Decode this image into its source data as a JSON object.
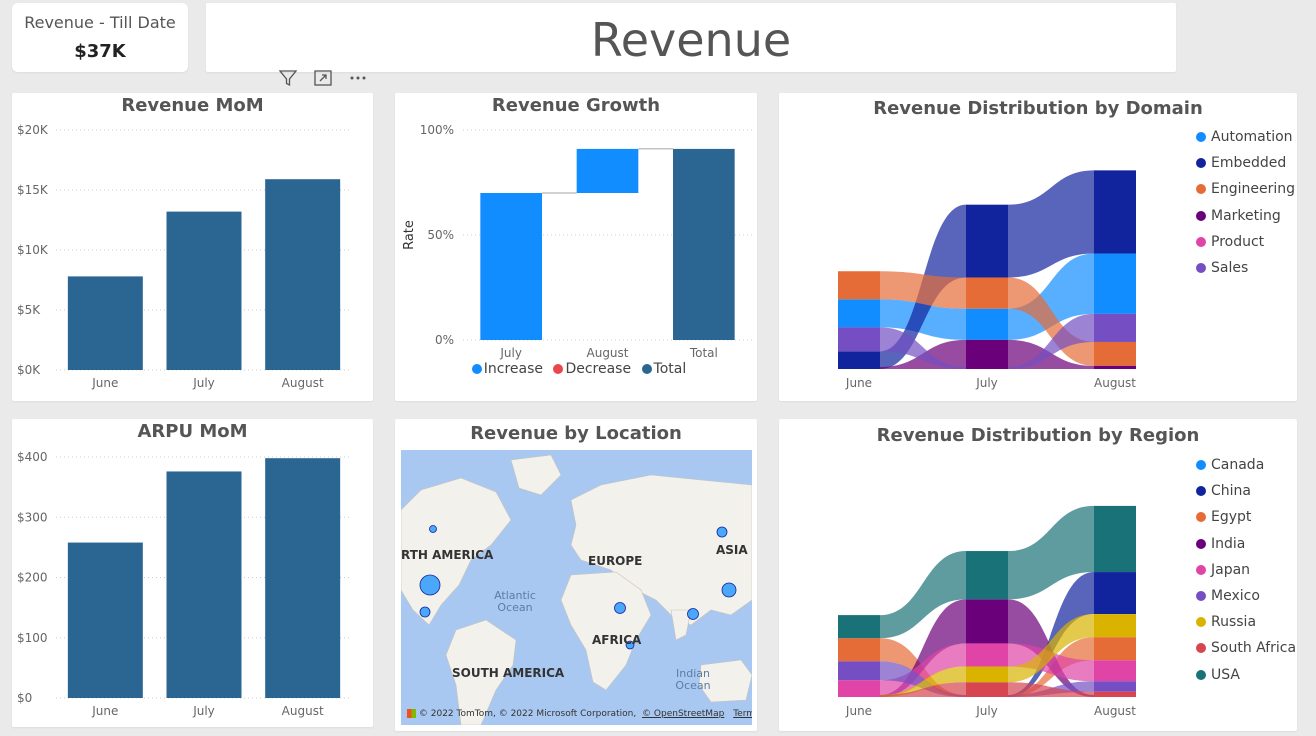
{
  "kpi": {
    "label": "Revenue - Till Date",
    "value": "$37K"
  },
  "header": {
    "title": "Revenue"
  },
  "chart_data": [
    {
      "id": "revenue_mom",
      "type": "bar",
      "title": "Revenue MoM",
      "categories": [
        "June",
        "July",
        "August"
      ],
      "values": [
        7800,
        13200,
        15900
      ],
      "ylim": [
        0,
        20000
      ],
      "yticks": [
        "$0K",
        "$5K",
        "$10K",
        "$15K",
        "$20K"
      ],
      "color": "#2b6591",
      "grid": true
    },
    {
      "id": "revenue_growth",
      "type": "bar",
      "subtype": "waterfall",
      "title": "Revenue Growth",
      "ylabel": "Rate",
      "categories": [
        "July",
        "August",
        "Total"
      ],
      "steps": [
        {
          "category": "July",
          "start": 0,
          "end": 70,
          "kind": "Increase"
        },
        {
          "category": "August",
          "start": 70,
          "end": 91,
          "kind": "Increase"
        },
        {
          "category": "Total",
          "start": 0,
          "end": 91,
          "kind": "Total"
        }
      ],
      "yticks": [
        "0%",
        "50%",
        "100%"
      ],
      "ylim": [
        0,
        100
      ],
      "legend": [
        {
          "label": "Increase",
          "color": "#118dff"
        },
        {
          "label": "Decrease",
          "color": "#e8484c"
        },
        {
          "label": "Total",
          "color": "#2b6591"
        }
      ]
    },
    {
      "id": "revenue_by_domain",
      "type": "area",
      "subtype": "ribbon",
      "title": "Revenue Distribution by Domain",
      "categories": [
        "June",
        "July",
        "August"
      ],
      "series": [
        {
          "name": "Automation",
          "color": "#118dff",
          "values": [
            2.7,
            3.0,
            5.8
          ]
        },
        {
          "name": "Embedded",
          "color": "#12239e",
          "values": [
            1.7,
            7.0,
            8.0
          ]
        },
        {
          "name": "Engineering",
          "color": "#e66c37",
          "values": [
            2.7,
            3.0,
            2.3
          ]
        },
        {
          "name": "Marketing",
          "color": "#6b007b",
          "values": [
            0,
            2.8,
            0.3
          ]
        },
        {
          "name": "Product",
          "color": "#e044a7",
          "values": [
            0,
            0,
            0
          ]
        },
        {
          "name": "Sales",
          "color": "#744ec2",
          "values": [
            2.3,
            0,
            2.7
          ]
        }
      ],
      "legend": [
        "Automation",
        "Embedded",
        "Engineering",
        "Marketing",
        "Product",
        "Sales"
      ]
    },
    {
      "id": "arpu_mom",
      "type": "bar",
      "title": "ARPU MoM",
      "categories": [
        "June",
        "July",
        "August"
      ],
      "values": [
        258,
        376,
        398
      ],
      "ylim": [
        0,
        400
      ],
      "yticks": [
        "$0",
        "$100",
        "$200",
        "$300",
        "$400"
      ],
      "color": "#2b6591",
      "grid": true
    },
    {
      "id": "revenue_by_region",
      "type": "area",
      "subtype": "ribbon",
      "title": "Revenue Distribution by Region",
      "categories": [
        "June",
        "July",
        "August"
      ],
      "series": [
        {
          "name": "Canada",
          "color": "#118dff",
          "values": [
            0,
            0,
            0
          ]
        },
        {
          "name": "China",
          "color": "#12239e",
          "values": [
            0,
            0,
            4.0
          ]
        },
        {
          "name": "Egypt",
          "color": "#e66c37",
          "values": [
            2.2,
            0,
            2.2
          ]
        },
        {
          "name": "India",
          "color": "#6b007b",
          "values": [
            0,
            4.2,
            0
          ]
        },
        {
          "name": "Japan",
          "color": "#e044a7",
          "values": [
            1.6,
            2.2,
            2.0
          ]
        },
        {
          "name": "Mexico",
          "color": "#744ec2",
          "values": [
            1.8,
            0,
            1.0
          ]
        },
        {
          "name": "Russia",
          "color": "#d9b300",
          "values": [
            0,
            1.5,
            2.2
          ]
        },
        {
          "name": "South Africa",
          "color": "#d64550",
          "values": [
            0,
            1.4,
            0.5
          ]
        },
        {
          "name": "USA",
          "color": "#197278",
          "values": [
            2.2,
            4.6,
            6.3
          ]
        }
      ],
      "legend": [
        "Canada",
        "China",
        "Egypt",
        "India",
        "Japan",
        "Mexico",
        "Russia",
        "South Africa",
        "USA"
      ]
    }
  ],
  "map": {
    "title": "Revenue by Location",
    "labels": {
      "north_america": "RTH AMERICA",
      "europe": "EUROPE",
      "asia": "ASIA",
      "africa": "AFRICA",
      "south_america": "SOUTH AMERICA",
      "atlantic": "Atlantic Ocean",
      "indian": "Indian Ocean"
    },
    "attribution": "© 2022 TomTom, © 2022 Microsoft Corporation,",
    "attribution_link": "© OpenStreetMap",
    "terms": "Terms"
  }
}
